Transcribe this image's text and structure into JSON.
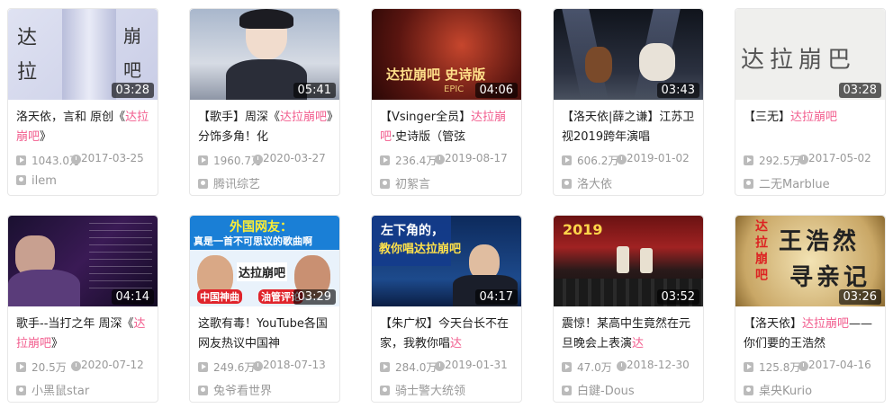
{
  "colors": {
    "highlight": "#f25d8e",
    "meta": "#999999"
  },
  "videos": [
    {
      "duration": "03:28",
      "title_pre": "洛天依，言和 原创《",
      "title_hl": "达拉崩吧",
      "title_post": "》",
      "plays": "1043.0万",
      "date": "2017-03-25",
      "uploader": "ilem",
      "thumb_text": [
        "达",
        "拉",
        "崩",
        "吧"
      ]
    },
    {
      "duration": "05:41",
      "title_pre": "【歌手】周深《",
      "title_hl": "达拉崩吧",
      "title_post": "》分饰多角！化",
      "plays": "1960.7万",
      "date": "2020-03-27",
      "uploader": "腾讯综艺"
    },
    {
      "duration": "04:06",
      "title_pre": "【Vsinger全员】",
      "title_hl": "达拉崩吧",
      "title_post": "·史诗版（管弦",
      "plays": "236.4万",
      "date": "2019-08-17",
      "uploader": "初絮言",
      "thumb_text": [
        "达拉崩吧 史诗版",
        "EPIC"
      ]
    },
    {
      "duration": "03:43",
      "title_pre": "【洛天依|薛之谦】江苏卫视2019跨年演唱",
      "title_hl": "",
      "title_post": "",
      "plays": "606.2万",
      "date": "2019-01-02",
      "uploader": "洛大依"
    },
    {
      "duration": "03:28",
      "title_pre": "【三无】",
      "title_hl": "达拉崩吧",
      "title_post": "",
      "plays": "292.5万",
      "date": "2017-05-02",
      "uploader": "二无Marblue",
      "thumb_text": [
        "达拉崩巴"
      ]
    },
    {
      "duration": "04:14",
      "title_pre": "歌手--当打之年 周深《",
      "title_hl": "达拉崩吧",
      "title_post": "》",
      "plays": "20.5万",
      "date": "2020-07-12",
      "uploader": "小黑鼠star"
    },
    {
      "duration": "03:29",
      "title_pre": "这歌有毒！YouTube各国网友热议中国神",
      "title_hl": "",
      "title_post": "",
      "plays": "249.6万",
      "date": "2018-07-13",
      "uploader": "兔爷看世界",
      "thumb_text": [
        "外国网友：",
        "真是一首不可思议的歌曲啊",
        "达拉崩吧",
        "中国神曲",
        "油管评论"
      ]
    },
    {
      "duration": "04:17",
      "title_pre": "【朱广权】今天台长不在家，我教你唱",
      "title_hl": "达",
      "title_post": "",
      "plays": "284.0万",
      "date": "2019-01-31",
      "uploader": "骑士警大统领",
      "thumb_text": [
        "左下角的，",
        "教你唱达拉崩吧"
      ]
    },
    {
      "duration": "03:52",
      "title_pre": "震惊！某高中生竟然在元旦晚会上表演",
      "title_hl": "达",
      "title_post": "",
      "plays": "47.0万",
      "date": "2018-12-30",
      "uploader": "白鍵-Dous",
      "thumb_text": [
        "2019"
      ]
    },
    {
      "duration": "03:26",
      "title_pre": "【洛天依】",
      "title_hl": "达拉崩吧",
      "title_post": "——你们要的王浩然",
      "plays": "125.8万",
      "date": "2017-04-16",
      "uploader": "桌央Kurio",
      "thumb_text": [
        "达拉崩吧",
        "王浩然",
        "寻亲记"
      ]
    }
  ]
}
